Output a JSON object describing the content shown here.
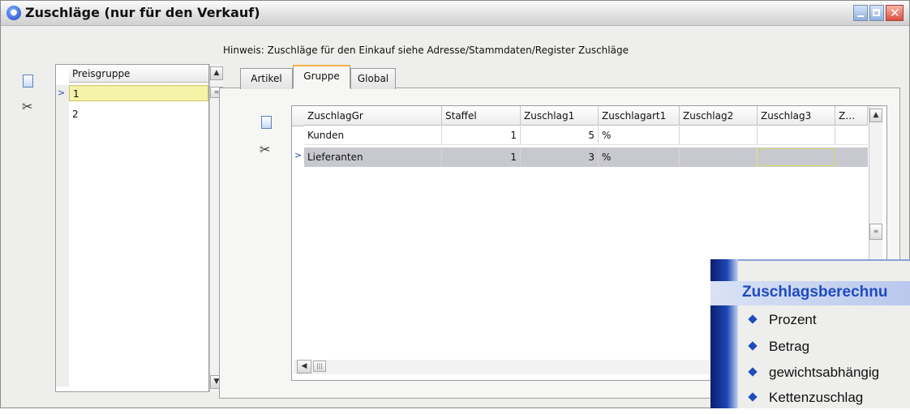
{
  "window": {
    "title": "Zuschläge (nur für den Verkauf)",
    "app_icon_glyph": "●",
    "controls": [
      "minimize-icon",
      "maximize-icon",
      "close-icon"
    ]
  },
  "hint": "Hinweis: Zuschläge für den Einkauf siehe Adresse/Stammdaten/Register Zuschläge",
  "price_groups": {
    "header": "Preisgruppe",
    "rows": [
      "1",
      "2"
    ],
    "selected_index": 0
  },
  "tabs": [
    {
      "label": "Artikel"
    },
    {
      "label": "Gruppe",
      "active": true
    },
    {
      "label": "Global"
    }
  ],
  "grid": {
    "columns": [
      "ZuschlagGr",
      "Staffel",
      "Zuschlag1",
      "Zuschlagart1",
      "Zuschlag2",
      "Zuschlag3",
      "Z…"
    ],
    "rows": [
      {
        "ZuschlagGr": "Kunden",
        "Staffel": "1",
        "Zuschlag1": "5",
        "Zuschlagart1": "%",
        "Zuschlag2": "",
        "Zuschlag3": ""
      },
      {
        "ZuschlagGr": "Lieferanten",
        "Staffel": "1",
        "Zuschlag1": "3",
        "Zuschlagart1": "%",
        "Zuschlag2": "",
        "Zuschlag3": ""
      }
    ],
    "selected_index": 1
  },
  "callout": {
    "title": "Zuschlagsberechnu",
    "items": [
      "Prozent",
      "Betrag",
      "gewichtsabhängig",
      "Kettenzuschlag"
    ]
  },
  "colors": {
    "selected_row_left": "#f4f3a8",
    "selected_row_grid": "#c8c9d0",
    "tab_accent": "#f0b24a",
    "callout_accent": "#1f4bbd"
  }
}
